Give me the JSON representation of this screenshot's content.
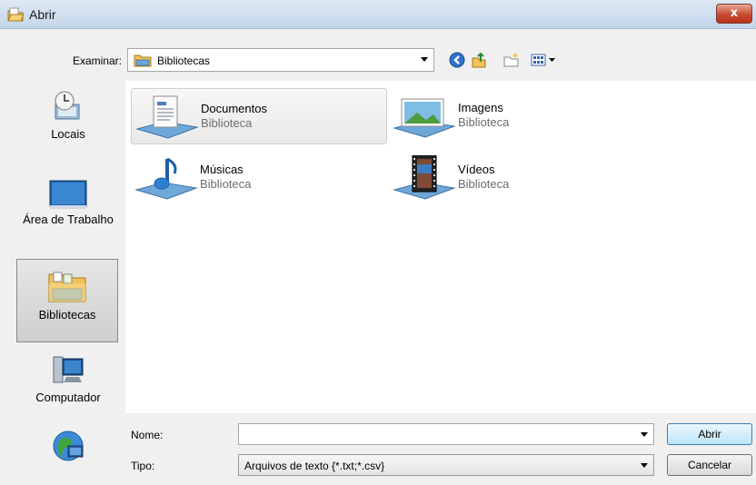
{
  "window": {
    "title": "Abrir",
    "close_glyph": "x"
  },
  "toolbar": {
    "lookin_label": "Examinar:",
    "lookin_value": "Bibliotecas",
    "icons": [
      "back-icon",
      "up-folder-icon",
      "new-folder-icon",
      "views-menu-icon"
    ]
  },
  "places": [
    {
      "label": "Locais",
      "icon": "recent-places-icon"
    },
    {
      "label": "Área de Trabalho",
      "icon": "desktop-icon"
    },
    {
      "label": "Bibliotecas",
      "icon": "libraries-icon",
      "selected": true
    },
    {
      "label": "Computador",
      "icon": "computer-icon"
    },
    {
      "label": "",
      "icon": "network-icon"
    }
  ],
  "libraries": [
    {
      "name": "Documentos",
      "type": "Biblioteca",
      "icon": "documents-library-icon"
    },
    {
      "name": "Imagens",
      "type": "Biblioteca",
      "icon": "pictures-library-icon"
    },
    {
      "name": "Músicas",
      "type": "Biblioteca",
      "icon": "music-library-icon"
    },
    {
      "name": "Vídeos",
      "type": "Biblioteca",
      "icon": "videos-library-icon"
    }
  ],
  "form": {
    "name_label": "Nome:",
    "name_value": "",
    "type_label": "Tipo:",
    "type_value": "Arquivos de texto {*.txt;*.csv}"
  },
  "buttons": {
    "open": "Abrir",
    "cancel": "Cancelar"
  },
  "colors": {
    "accent": "#3c7fb1",
    "close": "#c74b31",
    "selected_place": "#d4d4d4"
  }
}
